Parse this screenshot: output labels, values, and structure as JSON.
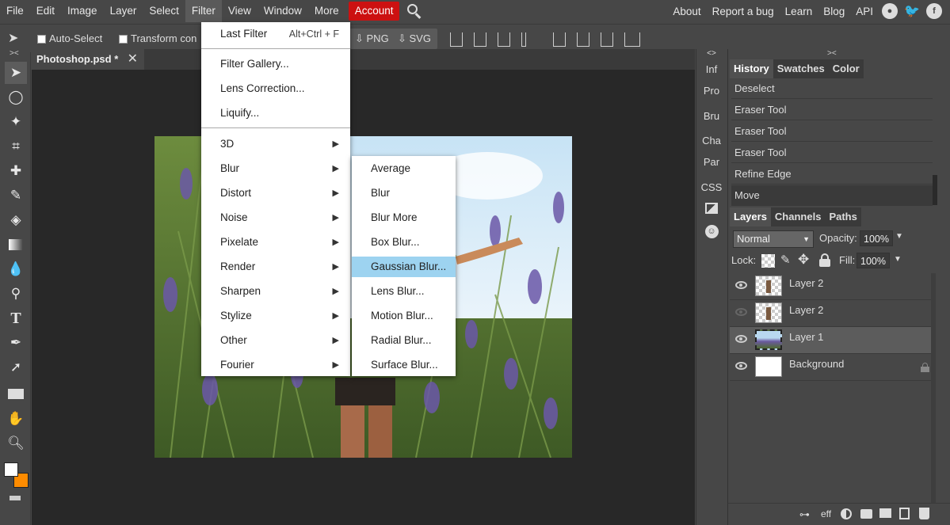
{
  "menubar": {
    "items": [
      "File",
      "Edit",
      "Image",
      "Layer",
      "Select",
      "Filter",
      "View",
      "Window",
      "More"
    ],
    "account": "Account",
    "right_links": [
      "About",
      "Report a bug",
      "Learn",
      "Blog",
      "API"
    ],
    "accent_color": "#cc1111"
  },
  "options": {
    "auto_select": "Auto-Select",
    "transform": "Transform con",
    "png": "PNG",
    "svg": "SVG"
  },
  "document": {
    "tab_title": "Photoshop.psd *"
  },
  "filter_menu": {
    "last_filter": "Last Filter",
    "last_filter_shortcut": "Alt+Ctrl + F",
    "group1": [
      "Filter Gallery...",
      "Lens Correction...",
      "Liquify..."
    ],
    "submenus": [
      "3D",
      "Blur",
      "Distort",
      "Noise",
      "Pixelate",
      "Render",
      "Sharpen",
      "Stylize",
      "Other",
      "Fourier"
    ]
  },
  "blur_submenu": {
    "items": [
      "Average",
      "Blur",
      "Blur More",
      "Box Blur...",
      "Gaussian Blur...",
      "Lens Blur...",
      "Motion Blur...",
      "Radial Blur...",
      "Surface Blur..."
    ],
    "highlighted": "Gaussian Blur...",
    "highlight_color": "#9dd3f0"
  },
  "mini_panel": [
    "Inf",
    "Pro",
    "Bru",
    "Cha",
    "Par",
    "CSS"
  ],
  "history": {
    "tabs": [
      "History",
      "Swatches",
      "Color"
    ],
    "items": [
      "Deselect",
      "Eraser Tool",
      "Eraser Tool",
      "Eraser Tool",
      "Refine Edge",
      "Move"
    ]
  },
  "layers": {
    "tabs": [
      "Layers",
      "Channels",
      "Paths"
    ],
    "blend_mode": "Normal",
    "opacity_label": "Opacity:",
    "opacity": "100%",
    "lock_label": "Lock:",
    "fill_label": "Fill:",
    "fill": "100%",
    "items": [
      {
        "name": "Layer 2",
        "visible": true
      },
      {
        "name": "Layer 2",
        "visible": false
      },
      {
        "name": "Layer 1",
        "visible": true,
        "selected": true
      },
      {
        "name": "Background",
        "visible": true,
        "locked": true
      }
    ],
    "footer_eff": "eff"
  },
  "colors": {
    "foreground": "#ffffff",
    "background": "#ff8c00"
  }
}
